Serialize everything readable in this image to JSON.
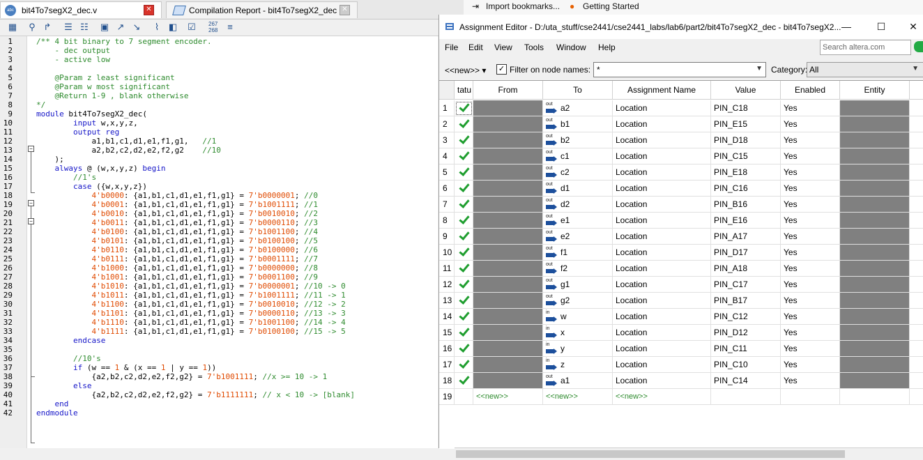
{
  "tabs": [
    {
      "label": "bit4To7segX2_dec.v",
      "icon": "abc-file-icon",
      "close": "✕"
    },
    {
      "label": "Compilation Report - bit4To7segX2_dec",
      "icon": "report-icon",
      "close": "✕"
    }
  ],
  "editor_toolbar": {
    "line_numbers_label_top": "267",
    "line_numbers_label_bottom": "268"
  },
  "code": {
    "line_numbers": [
      "1",
      "2",
      "3",
      "4",
      "5",
      "6",
      "7",
      "8",
      "9",
      "10",
      "11",
      "12",
      "13",
      "14",
      "15",
      "16",
      "17",
      "18",
      "19",
      "20",
      "21",
      "22",
      "23",
      "24",
      "25",
      "26",
      "27",
      "28",
      "29",
      "30",
      "31",
      "32",
      "33",
      "34",
      "35",
      "36",
      "37",
      "38",
      "39",
      "40",
      "41",
      "42"
    ],
    "lines": [
      [
        {
          "t": "/** 4 bit binary to 7 segment encoder.",
          "c": "c"
        }
      ],
      [
        {
          "t": "    - dec output",
          "c": "c"
        }
      ],
      [
        {
          "t": "    - active low",
          "c": "c"
        }
      ],
      [],
      [
        {
          "t": "    @Param z least significant",
          "c": "c"
        }
      ],
      [
        {
          "t": "    @Param w most significant",
          "c": "c"
        }
      ],
      [
        {
          "t": "    @Return 1-9 , blank otherwise",
          "c": "c"
        }
      ],
      [
        {
          "t": "*/",
          "c": "c"
        }
      ],
      [
        {
          "t": "module",
          "c": "k"
        },
        {
          "t": " bit4To7segX2_dec(",
          "c": "d"
        }
      ],
      [
        {
          "t": "        ",
          "c": "d"
        },
        {
          "t": "input",
          "c": "k"
        },
        {
          "t": " w,x,y,z,",
          "c": "d"
        }
      ],
      [
        {
          "t": "        ",
          "c": "d"
        },
        {
          "t": "output reg",
          "c": "k"
        }
      ],
      [
        {
          "t": "            a1,b1,c1,d1,e1,f1,g1,   ",
          "c": "d"
        },
        {
          "t": "//1",
          "c": "c"
        }
      ],
      [
        {
          "t": "            a2,b2,c2,d2,e2,f2,g2    ",
          "c": "d"
        },
        {
          "t": "//10",
          "c": "c"
        }
      ],
      [
        {
          "t": "    );",
          "c": "d"
        }
      ],
      [
        {
          "t": "    ",
          "c": "d"
        },
        {
          "t": "always",
          "c": "k"
        },
        {
          "t": " @ (w,x,y,z) ",
          "c": "d"
        },
        {
          "t": "begin",
          "c": "k"
        }
      ],
      [
        {
          "t": "        //1's",
          "c": "c"
        }
      ],
      [
        {
          "t": "        ",
          "c": "d"
        },
        {
          "t": "case",
          "c": "k"
        },
        {
          "t": " ({w,x,y,z})",
          "c": "d"
        }
      ],
      [
        {
          "t": "            4'b0000",
          "c": "n"
        },
        {
          "t": ": {a1,b1,c1,d1,e1,f1,g1} = ",
          "c": "d"
        },
        {
          "t": "7'b0000001",
          "c": "n"
        },
        {
          "t": "; ",
          "c": "d"
        },
        {
          "t": "//0",
          "c": "c"
        }
      ],
      [
        {
          "t": "            4'b0001",
          "c": "n"
        },
        {
          "t": ": {a1,b1,c1,d1,e1,f1,g1} = ",
          "c": "d"
        },
        {
          "t": "7'b1001111",
          "c": "n"
        },
        {
          "t": "; ",
          "c": "d"
        },
        {
          "t": "//1",
          "c": "c"
        }
      ],
      [
        {
          "t": "            4'b0010",
          "c": "n"
        },
        {
          "t": ": {a1,b1,c1,d1,e1,f1,g1} = ",
          "c": "d"
        },
        {
          "t": "7'b0010010",
          "c": "n"
        },
        {
          "t": "; ",
          "c": "d"
        },
        {
          "t": "//2",
          "c": "c"
        }
      ],
      [
        {
          "t": "            4'b0011",
          "c": "n"
        },
        {
          "t": ": {a1,b1,c1,d1,e1,f1,g1} = ",
          "c": "d"
        },
        {
          "t": "7'b0000110",
          "c": "n"
        },
        {
          "t": "; ",
          "c": "d"
        },
        {
          "t": "//3",
          "c": "c"
        }
      ],
      [
        {
          "t": "            4'b0100",
          "c": "n"
        },
        {
          "t": ": {a1,b1,c1,d1,e1,f1,g1} = ",
          "c": "d"
        },
        {
          "t": "7'b1001100",
          "c": "n"
        },
        {
          "t": "; ",
          "c": "d"
        },
        {
          "t": "//4",
          "c": "c"
        }
      ],
      [
        {
          "t": "            4'b0101",
          "c": "n"
        },
        {
          "t": ": {a1,b1,c1,d1,e1,f1,g1} = ",
          "c": "d"
        },
        {
          "t": "7'b0100100",
          "c": "n"
        },
        {
          "t": "; ",
          "c": "d"
        },
        {
          "t": "//5",
          "c": "c"
        }
      ],
      [
        {
          "t": "            4'b0110",
          "c": "n"
        },
        {
          "t": ": {a1,b1,c1,d1,e1,f1,g1} = ",
          "c": "d"
        },
        {
          "t": "7'b0100000",
          "c": "n"
        },
        {
          "t": "; ",
          "c": "d"
        },
        {
          "t": "//6",
          "c": "c"
        }
      ],
      [
        {
          "t": "            4'b0111",
          "c": "n"
        },
        {
          "t": ": {a1,b1,c1,d1,e1,f1,g1} = ",
          "c": "d"
        },
        {
          "t": "7'b0001111",
          "c": "n"
        },
        {
          "t": "; ",
          "c": "d"
        },
        {
          "t": "//7",
          "c": "c"
        }
      ],
      [
        {
          "t": "            4'b1000",
          "c": "n"
        },
        {
          "t": ": {a1,b1,c1,d1,e1,f1,g1} = ",
          "c": "d"
        },
        {
          "t": "7'b0000000",
          "c": "n"
        },
        {
          "t": "; ",
          "c": "d"
        },
        {
          "t": "//8",
          "c": "c"
        }
      ],
      [
        {
          "t": "            4'b1001",
          "c": "n"
        },
        {
          "t": ": {a1,b1,c1,d1,e1,f1,g1} = ",
          "c": "d"
        },
        {
          "t": "7'b0001100",
          "c": "n"
        },
        {
          "t": "; ",
          "c": "d"
        },
        {
          "t": "//9",
          "c": "c"
        }
      ],
      [
        {
          "t": "            4'b1010",
          "c": "n"
        },
        {
          "t": ": {a1,b1,c1,d1,e1,f1,g1} = ",
          "c": "d"
        },
        {
          "t": "7'b0000001",
          "c": "n"
        },
        {
          "t": "; ",
          "c": "d"
        },
        {
          "t": "//10 -> 0",
          "c": "c"
        }
      ],
      [
        {
          "t": "            4'b1011",
          "c": "n"
        },
        {
          "t": ": {a1,b1,c1,d1,e1,f1,g1} = ",
          "c": "d"
        },
        {
          "t": "7'b1001111",
          "c": "n"
        },
        {
          "t": "; ",
          "c": "d"
        },
        {
          "t": "//11 -> 1",
          "c": "c"
        }
      ],
      [
        {
          "t": "            4'b1100",
          "c": "n"
        },
        {
          "t": ": {a1,b1,c1,d1,e1,f1,g1} = ",
          "c": "d"
        },
        {
          "t": "7'b0010010",
          "c": "n"
        },
        {
          "t": "; ",
          "c": "d"
        },
        {
          "t": "//12 -> 2",
          "c": "c"
        }
      ],
      [
        {
          "t": "            4'b1101",
          "c": "n"
        },
        {
          "t": ": {a1,b1,c1,d1,e1,f1,g1} = ",
          "c": "d"
        },
        {
          "t": "7'b0000110",
          "c": "n"
        },
        {
          "t": "; ",
          "c": "d"
        },
        {
          "t": "//13 -> 3",
          "c": "c"
        }
      ],
      [
        {
          "t": "            4'b1110",
          "c": "n"
        },
        {
          "t": ": {a1,b1,c1,d1,e1,f1,g1} = ",
          "c": "d"
        },
        {
          "t": "7'b1001100",
          "c": "n"
        },
        {
          "t": "; ",
          "c": "d"
        },
        {
          "t": "//14 -> 4",
          "c": "c"
        }
      ],
      [
        {
          "t": "            4'b1111",
          "c": "n"
        },
        {
          "t": ": {a1,b1,c1,d1,e1,f1,g1} = ",
          "c": "d"
        },
        {
          "t": "7'b0100100",
          "c": "n"
        },
        {
          "t": "; ",
          "c": "d"
        },
        {
          "t": "//15 -> 5",
          "c": "c"
        }
      ],
      [
        {
          "t": "        ",
          "c": "d"
        },
        {
          "t": "endcase",
          "c": "k"
        }
      ],
      [],
      [
        {
          "t": "        //10's",
          "c": "c"
        }
      ],
      [
        {
          "t": "        ",
          "c": "d"
        },
        {
          "t": "if",
          "c": "k"
        },
        {
          "t": " (w == ",
          "c": "d"
        },
        {
          "t": "1",
          "c": "n"
        },
        {
          "t": " & (x == ",
          "c": "d"
        },
        {
          "t": "1",
          "c": "n"
        },
        {
          "t": " | y == ",
          "c": "d"
        },
        {
          "t": "1",
          "c": "n"
        },
        {
          "t": "))",
          "c": "d"
        }
      ],
      [
        {
          "t": "            {a2,b2,c2,d2,e2,f2,g2} = ",
          "c": "d"
        },
        {
          "t": "7'b1001111",
          "c": "n"
        },
        {
          "t": "; ",
          "c": "d"
        },
        {
          "t": "//x >= 10 -> 1",
          "c": "c"
        }
      ],
      [
        {
          "t": "        ",
          "c": "d"
        },
        {
          "t": "else",
          "c": "k"
        }
      ],
      [
        {
          "t": "            {a2,b2,c2,d2,e2,f2,g2} = ",
          "c": "d"
        },
        {
          "t": "7'b1111111",
          "c": "n"
        },
        {
          "t": "; ",
          "c": "d"
        },
        {
          "t": "// x < 10 -> [blank]",
          "c": "c"
        }
      ],
      [
        {
          "t": "    ",
          "c": "d"
        },
        {
          "t": "end",
          "c": "k"
        }
      ],
      [
        {
          "t": "endmodule",
          "c": "k"
        }
      ]
    ]
  },
  "background_bar": {
    "import": "Import bookmarks...",
    "getting_started": "Getting Started"
  },
  "assignment_editor": {
    "title": "Assignment Editor - D:/uta_stuff/cse2441/cse2441_labs/lab6/part2/bit4To7segX2_dec - bit4To7segX2...",
    "window_buttons": {
      "minimize": "—",
      "maximize": "☐",
      "close": "✕"
    },
    "menu": [
      "File",
      "Edit",
      "View",
      "Tools",
      "Window",
      "Help"
    ],
    "search_placeholder": "Search altera.com",
    "filter": {
      "new_dropdown": "<<new>> ▾",
      "checkbox": "✓",
      "label": "Filter on node names:",
      "value": "*",
      "category_label": "Category:",
      "category_value": "All"
    },
    "headers": [
      "tatu",
      "From",
      "To",
      "Assignment Name",
      "Value",
      "Enabled",
      "Entity"
    ],
    "rows": [
      {
        "n": "1",
        "to": "a2",
        "dir": "out",
        "name": "Location",
        "value": "PIN_C18",
        "enabled": "Yes"
      },
      {
        "n": "2",
        "to": "b1",
        "dir": "out",
        "name": "Location",
        "value": "PIN_E15",
        "enabled": "Yes"
      },
      {
        "n": "3",
        "to": "b2",
        "dir": "out",
        "name": "Location",
        "value": "PIN_D18",
        "enabled": "Yes"
      },
      {
        "n": "4",
        "to": "c1",
        "dir": "out",
        "name": "Location",
        "value": "PIN_C15",
        "enabled": "Yes"
      },
      {
        "n": "5",
        "to": "c2",
        "dir": "out",
        "name": "Location",
        "value": "PIN_E18",
        "enabled": "Yes"
      },
      {
        "n": "6",
        "to": "d1",
        "dir": "out",
        "name": "Location",
        "value": "PIN_C16",
        "enabled": "Yes"
      },
      {
        "n": "7",
        "to": "d2",
        "dir": "out",
        "name": "Location",
        "value": "PIN_B16",
        "enabled": "Yes"
      },
      {
        "n": "8",
        "to": "e1",
        "dir": "out",
        "name": "Location",
        "value": "PIN_E16",
        "enabled": "Yes"
      },
      {
        "n": "9",
        "to": "e2",
        "dir": "out",
        "name": "Location",
        "value": "PIN_A17",
        "enabled": "Yes"
      },
      {
        "n": "10",
        "to": "f1",
        "dir": "out",
        "name": "Location",
        "value": "PIN_D17",
        "enabled": "Yes"
      },
      {
        "n": "11",
        "to": "f2",
        "dir": "out",
        "name": "Location",
        "value": "PIN_A18",
        "enabled": "Yes"
      },
      {
        "n": "12",
        "to": "g1",
        "dir": "out",
        "name": "Location",
        "value": "PIN_C17",
        "enabled": "Yes"
      },
      {
        "n": "13",
        "to": "g2",
        "dir": "out",
        "name": "Location",
        "value": "PIN_B17",
        "enabled": "Yes"
      },
      {
        "n": "14",
        "to": "w",
        "dir": "in",
        "name": "Location",
        "value": "PIN_C12",
        "enabled": "Yes"
      },
      {
        "n": "15",
        "to": "x",
        "dir": "in",
        "name": "Location",
        "value": "PIN_D12",
        "enabled": "Yes"
      },
      {
        "n": "16",
        "to": "y",
        "dir": "in",
        "name": "Location",
        "value": "PIN_C11",
        "enabled": "Yes"
      },
      {
        "n": "17",
        "to": "z",
        "dir": "in",
        "name": "Location",
        "value": "PIN_C10",
        "enabled": "Yes"
      },
      {
        "n": "18",
        "to": "a1",
        "dir": "out",
        "name": "Location",
        "value": "PIN_C14",
        "enabled": "Yes"
      }
    ],
    "new_row": {
      "n": "19",
      "from": "<<new>>",
      "to": "<<new>>",
      "name": "<<new>>"
    }
  }
}
